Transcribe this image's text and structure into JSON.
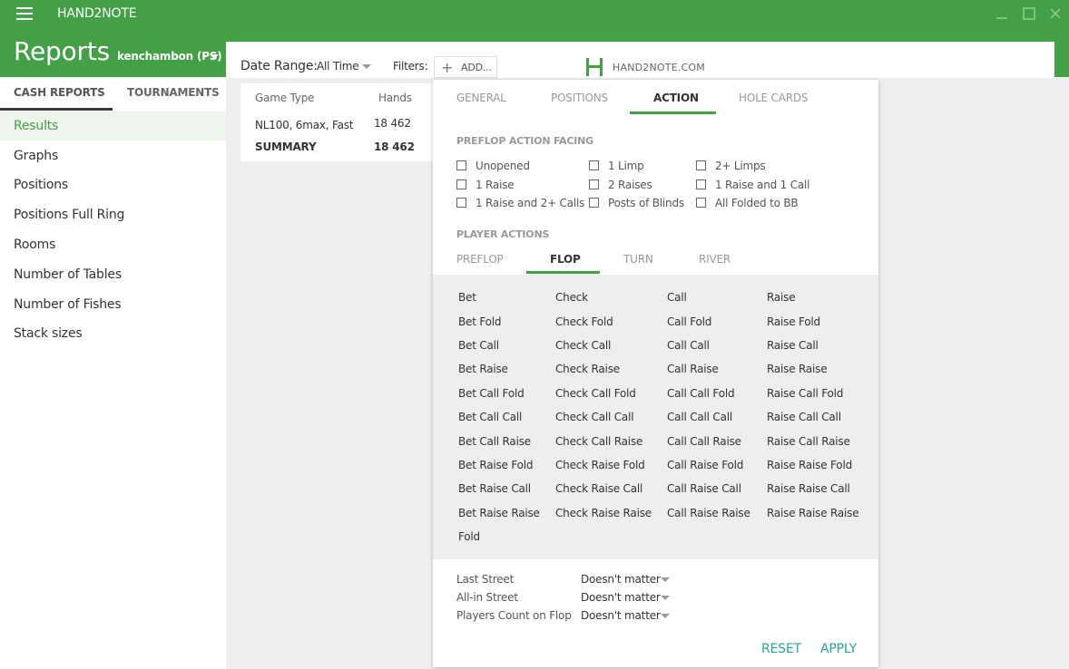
{
  "app": {
    "title": "HAND2NOTE",
    "page": "Reports",
    "account": "kenchambon (PS)"
  },
  "sidebar": {
    "tabs": [
      "CASH REPORTS",
      "TOURNAMENTS"
    ],
    "items": [
      "Results",
      "Graphs",
      "Positions",
      "Positions Full Ring",
      "Rooms",
      "Number of Tables",
      "Number of Fishes",
      "Stack sizes"
    ]
  },
  "topbar": {
    "date_label": "Date Range:",
    "date_value": "All Time",
    "filters_label": "Filters:",
    "add_label": "ADD...",
    "logo": "HAND2NOTE.COM"
  },
  "table": {
    "headers": [
      "Game Type",
      "Hands"
    ],
    "rows": [
      [
        "NL100, 6max, Fast",
        "18 462"
      ],
      [
        "SUMMARY",
        "18 462"
      ]
    ]
  },
  "filter_panel": {
    "tabs": [
      "GENERAL",
      "POSITIONS",
      "ACTION",
      "HOLE CARDS"
    ],
    "preflop_title": "PREFLOP ACTION FACING",
    "preflop_options": [
      "Unopened",
      "1 Limp",
      "2+ Limps",
      "1 Raise",
      "2 Raises",
      "1 Raise and 1 Call",
      "1 Raise and 2+ Calls",
      "Posts of Blinds",
      "All Folded to BB"
    ],
    "player_actions_title": "PLAYER ACTIONS",
    "street_tabs": [
      "PREFLOP",
      "FLOP",
      "TURN",
      "RIVER"
    ],
    "actions": [
      [
        "Bet",
        "Bet Fold",
        "Bet Call",
        "Bet Raise",
        "Bet Call Fold",
        "Bet Call Call",
        "Bet Call Raise",
        "Bet Raise Fold",
        "Bet Raise Call",
        "Bet Raise Raise",
        "Fold"
      ],
      [
        "Check",
        "Check Fold",
        "Check Call",
        "Check Raise",
        "Check Call Fold",
        "Check Call Call",
        "Check Call Raise",
        "Check Raise Fold",
        "Check Raise Call",
        "Check Raise Raise"
      ],
      [
        "Call",
        "Call Fold",
        "Call Call",
        "Call Raise",
        "Call Call Fold",
        "Call Call Call",
        "Call Call Raise",
        "Call Raise Fold",
        "Call Raise Call",
        "Call Raise Raise"
      ],
      [
        "Raise",
        "Raise Fold",
        "Raise Call",
        "Raise Raise",
        "Raise Call Fold",
        "Raise Call Call",
        "Raise Call Raise",
        "Raise Raise Fold",
        "Raise Raise Call",
        "Raise Raise Raise"
      ]
    ],
    "dropdowns": [
      {
        "label": "Last Street",
        "value": "Doesn't matter"
      },
      {
        "label": "All-in Street",
        "value": "Doesn't matter"
      },
      {
        "label": "Players Count on Flop",
        "value": "Doesn't matter"
      }
    ],
    "reset_label": "RESET",
    "apply_label": "APPLY"
  },
  "colors": {
    "brand_green": "#43a046",
    "accent_teal": "#26a69a"
  }
}
